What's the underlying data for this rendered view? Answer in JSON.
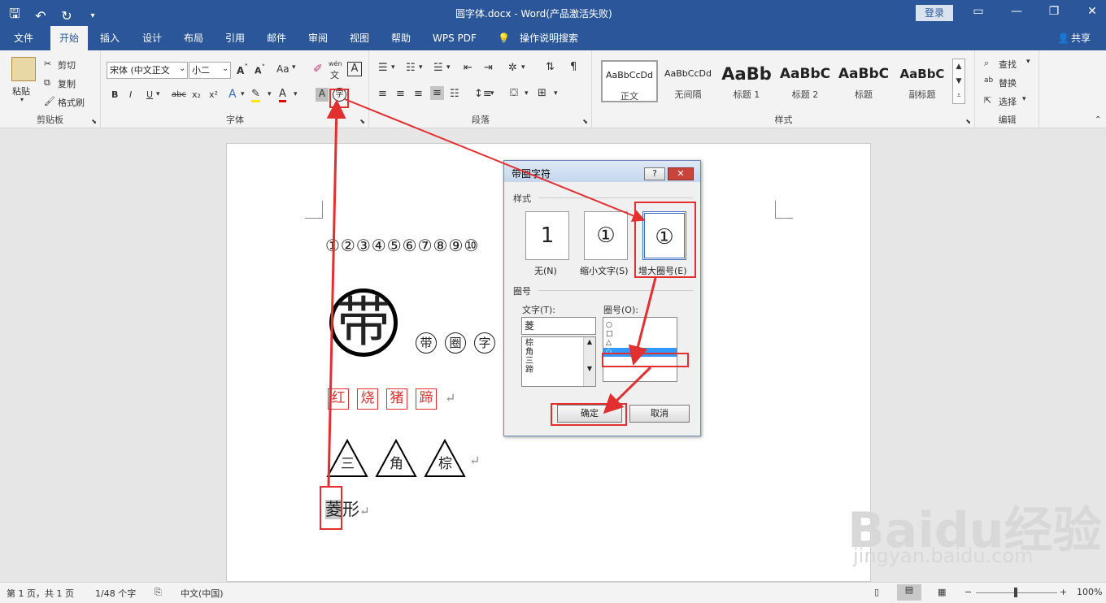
{
  "window": {
    "title": "圆字体.docx - Word(产品激活失败)",
    "login_label": "登录",
    "share_label": "共享",
    "tell_me": "操作说明搜索"
  },
  "tabs": [
    "文件",
    "开始",
    "插入",
    "设计",
    "布局",
    "引用",
    "邮件",
    "审阅",
    "视图",
    "帮助",
    "WPS PDF"
  ],
  "ribbon": {
    "clipboard": {
      "paste": "粘贴",
      "cut": "剪切",
      "copy": "复制",
      "format_painter": "格式刷",
      "label": "剪贴板"
    },
    "font": {
      "name": "宋体 (中文正文",
      "size": "小二",
      "label": "字体",
      "aa": "Aa",
      "wen": "wén"
    },
    "paragraph": {
      "label": "段落"
    },
    "styles": {
      "label": "样式",
      "items": [
        {
          "preview": "AaBbCcDd",
          "name": "正文"
        },
        {
          "preview": "AaBbCcDd",
          "name": "无间隔"
        },
        {
          "preview": "AaBb",
          "name": "标题 1"
        },
        {
          "preview": "AaBbC",
          "name": "标题 2"
        },
        {
          "preview": "AaBbC",
          "name": "标题"
        },
        {
          "preview": "AaBbC",
          "name": "副标题"
        }
      ]
    },
    "editing": {
      "find": "查找",
      "replace": "替换",
      "select": "选择",
      "label": "编辑"
    }
  },
  "document": {
    "line1": "①②③④⑤⑥⑦⑧⑨⑩",
    "big_char": "带",
    "circled_chars": [
      "带",
      "圈",
      "字"
    ],
    "boxed_chars": [
      "红",
      "烧",
      "猪",
      "蹄"
    ],
    "triangle_chars": [
      "三",
      "角",
      "棕"
    ],
    "last_line_sel": "菱",
    "last_line_rest": "形"
  },
  "dialog": {
    "title": "带圈字符",
    "help": "?",
    "close": "✕",
    "style_section": "样式",
    "style_options": [
      {
        "glyph": "1",
        "label": "无(N)"
      },
      {
        "glyph": "①",
        "label": "缩小文字(S)"
      },
      {
        "glyph": "①",
        "label": "增大圈号(E)"
      }
    ],
    "enclosure_section": "圈号",
    "text_label": "文字(T):",
    "text_value": "菱",
    "text_list": [
      "棕",
      "角",
      "三",
      "蹄"
    ],
    "enclosure_label": "圈号(O):",
    "enclosure_list": [
      "○",
      "□",
      "△",
      "◇"
    ],
    "ok": "确定",
    "cancel": "取消"
  },
  "status": {
    "page": "第 1 页，共 1 页",
    "words": "1/48 个字",
    "lang": "中文(中国)",
    "zoom": "100%"
  },
  "watermark": {
    "brand": "Baidu经验",
    "url": "jingyan.baidu.com"
  }
}
